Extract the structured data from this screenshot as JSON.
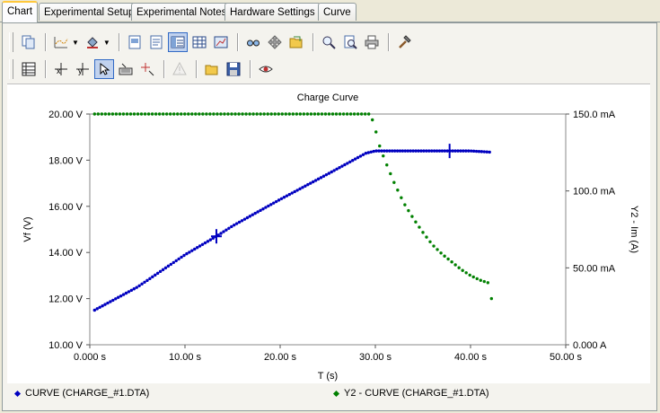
{
  "tabs": [
    "Chart",
    "Experimental Setup",
    "Experimental Notes",
    "Hardware Settings",
    "Curve"
  ],
  "toolbar1": [
    "copy-icon",
    "series-style-icon",
    "fill-color-icon",
    "page-view-icon",
    "print-preview-icon",
    "data-table-icon",
    "grid-icon",
    "chart-view-icon",
    "glasses-icon",
    "move-icon",
    "open-folder-icon",
    "zoom-icon",
    "zoom-page-icon",
    "print-icon",
    "hammer-icon"
  ],
  "toolbar2": [
    "table-icon",
    "cursor-x-icon",
    "cursor-y-icon",
    "pointer-select-icon",
    "keyboard-icon",
    "crosshair-icon",
    "warning-icon",
    "open-file-icon",
    "save-icon",
    "eye-icon"
  ],
  "colors": {
    "series1": "#0000c0",
    "series2": "#008000"
  },
  "chart_data": {
    "type": "scatter",
    "title": "Charge Curve",
    "xlabel": "T (s)",
    "ylabel": "Vf (V)",
    "y2label": "Y2 - Im (A)",
    "xlim": [
      0,
      50
    ],
    "ylim": [
      10,
      20
    ],
    "y2lim": [
      0,
      150
    ],
    "xticks": [
      "0.000 s",
      "10.00 s",
      "20.00 s",
      "30.00 s",
      "40.00 s",
      "50.00 s"
    ],
    "yticks": [
      "10.00 V",
      "12.00 V",
      "14.00 V",
      "16.00 V",
      "18.00 V",
      "20.00 V"
    ],
    "y2ticks": [
      "0.000 A",
      "50.00 mA",
      "100.0 mA",
      "150.0 mA"
    ],
    "grid": false,
    "legend_position": "bottom",
    "series": [
      {
        "name": "CURVE (CHARGE_#1.DTA)",
        "axis": "left",
        "points": [
          [
            0.5,
            11.5
          ],
          [
            5,
            12.5
          ],
          [
            10,
            13.9
          ],
          [
            13.3,
            14.7
          ],
          [
            15,
            15.15
          ],
          [
            20,
            16.3
          ],
          [
            25,
            17.4
          ],
          [
            29,
            18.3
          ],
          [
            30,
            18.4
          ],
          [
            35,
            18.4
          ],
          [
            40,
            18.4
          ],
          [
            42,
            18.35
          ]
        ]
      },
      {
        "name": "Y2 - CURVE (CHARGE_#1.DTA)",
        "axis": "right",
        "points": [
          [
            0.5,
            150
          ],
          [
            29.5,
            150
          ],
          [
            30,
            140
          ],
          [
            30.5,
            128
          ],
          [
            31,
            120
          ],
          [
            32,
            105
          ],
          [
            33,
            92
          ],
          [
            34,
            82
          ],
          [
            35,
            73
          ],
          [
            36,
            65
          ],
          [
            37,
            59
          ],
          [
            38,
            54
          ],
          [
            39,
            49
          ],
          [
            40,
            45
          ],
          [
            41,
            42
          ],
          [
            42,
            40
          ],
          [
            42.2,
            30
          ]
        ]
      }
    ],
    "cursors": [
      [
        13.3,
        14.7
      ],
      [
        37.8,
        18.4
      ]
    ]
  }
}
